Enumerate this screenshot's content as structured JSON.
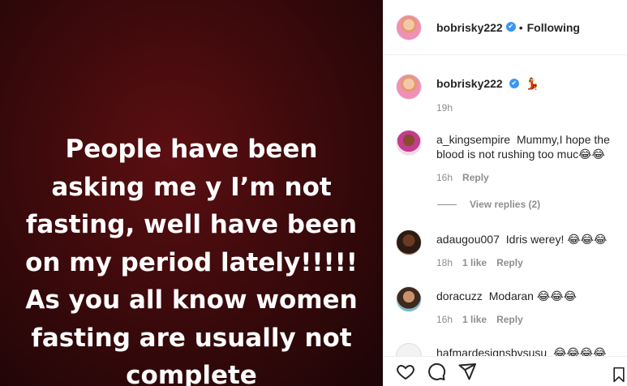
{
  "post": {
    "media_text": "People have been\nasking me y I’m not\nfasting, well have been\non my period lately!!!!!\nAs you all know women\nfasting are usually not\ncomplete"
  },
  "header": {
    "username": "bobrisky222",
    "separator": "•",
    "follow_status": "Following"
  },
  "caption": {
    "username": "bobrisky222",
    "text": "💃",
    "time": "19h"
  },
  "comments": [
    {
      "username": "a_kingsempire",
      "text": "Mummy,I hope the blood is not rushing too muc😂😂",
      "time": "16h",
      "reply_label": "Reply",
      "view_replies": "View replies (2)"
    },
    {
      "username": "adaugou007",
      "text": "Idris werey! 😂😂😂",
      "time": "18h",
      "likes": "1 like",
      "reply_label": "Reply"
    },
    {
      "username": "doracuzz",
      "text": "Modaran 😂😂😂",
      "time": "16h",
      "likes": "1 like",
      "reply_label": "Reply"
    },
    {
      "username": "hafmardesignsbysusu",
      "text": "😂😂😂😂😂"
    }
  ],
  "icons": {
    "like": "heart-icon",
    "comment": "comment-icon",
    "share": "share-icon",
    "save": "bookmark-icon",
    "verified": "verified-badge-icon"
  },
  "colors": {
    "verified": "#3897f0",
    "muted": "#8e8e8e",
    "media_bg": "#3e0a0c"
  }
}
